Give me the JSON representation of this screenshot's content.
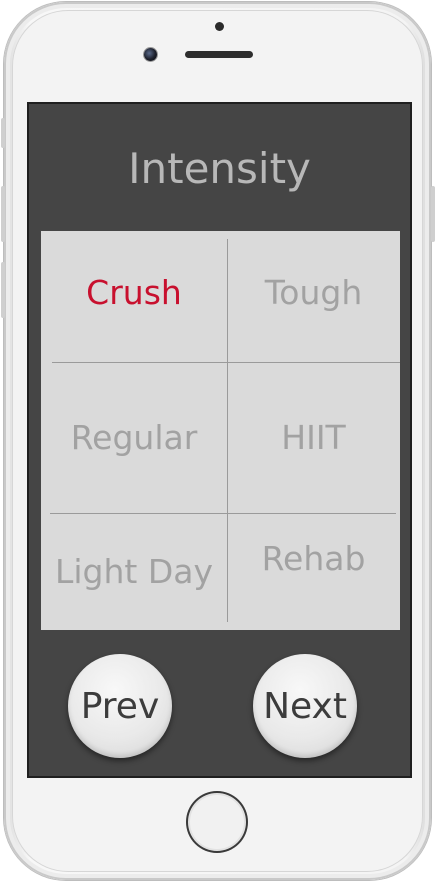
{
  "screen": {
    "title": "Intensity"
  },
  "options": [
    {
      "label": "Crush",
      "selected": true
    },
    {
      "label": "Tough",
      "selected": false
    },
    {
      "label": "Regular",
      "selected": false
    },
    {
      "label": "HIIT",
      "selected": false
    },
    {
      "label": "Light Day",
      "selected": false
    },
    {
      "label": "Rehab",
      "selected": false
    }
  ],
  "nav": {
    "prev_label": "Prev",
    "next_label": "Next"
  },
  "colors": {
    "screen_background": "#454545",
    "grid_background": "#dadada",
    "option_text": "#a2a2a2",
    "selected_text": "#c8102e",
    "title_text": "#b8b8b8"
  }
}
